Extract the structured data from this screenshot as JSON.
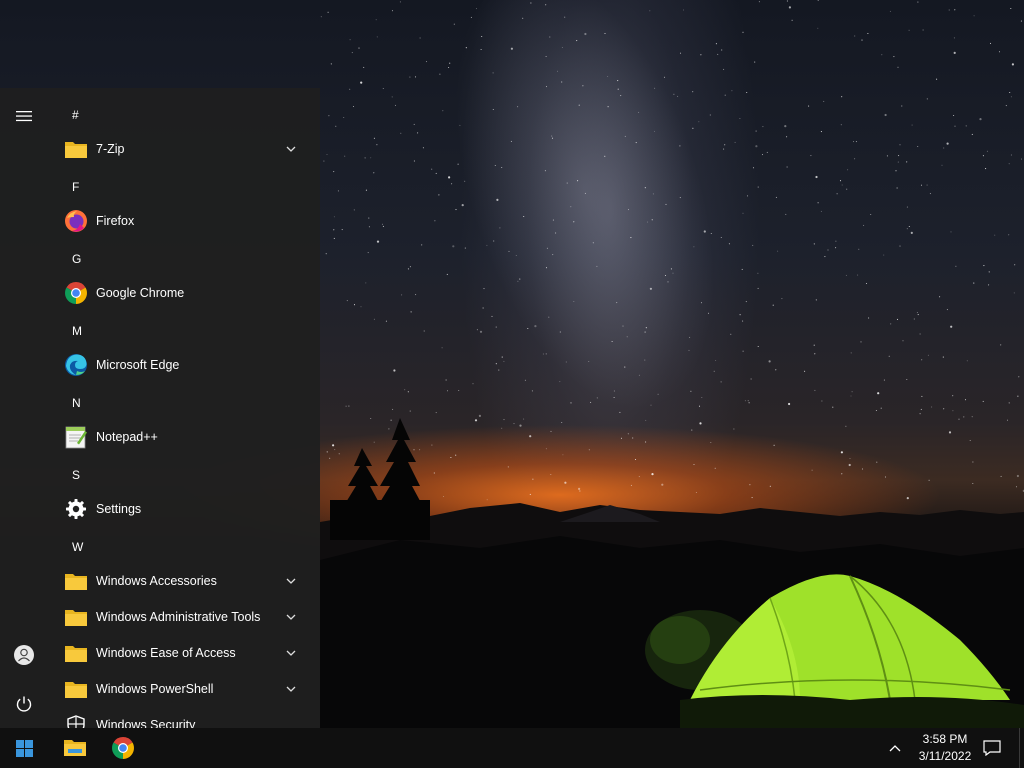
{
  "start_menu": {
    "rail": {
      "menu_icon": "hamburger-icon",
      "account_icon": "user-icon",
      "power_icon": "power-icon"
    },
    "sections": [
      {
        "letter": "#",
        "apps": [
          {
            "label": "7-Zip",
            "icon": "folder-icon",
            "expandable": true
          }
        ]
      },
      {
        "letter": "F",
        "apps": [
          {
            "label": "Firefox",
            "icon": "firefox-icon",
            "expandable": false
          }
        ]
      },
      {
        "letter": "G",
        "apps": [
          {
            "label": "Google Chrome",
            "icon": "chrome-icon",
            "expandable": false
          }
        ]
      },
      {
        "letter": "M",
        "apps": [
          {
            "label": "Microsoft Edge",
            "icon": "edge-icon",
            "expandable": false
          }
        ]
      },
      {
        "letter": "N",
        "apps": [
          {
            "label": "Notepad++",
            "icon": "notepad-plus-plus-icon",
            "expandable": false
          }
        ]
      },
      {
        "letter": "S",
        "apps": [
          {
            "label": "Settings",
            "icon": "gear-icon",
            "expandable": false
          }
        ]
      },
      {
        "letter": "W",
        "apps": [
          {
            "label": "Windows Accessories",
            "icon": "folder-icon",
            "expandable": true
          },
          {
            "label": "Windows Administrative Tools",
            "icon": "folder-icon",
            "expandable": true
          },
          {
            "label": "Windows Ease of Access",
            "icon": "folder-icon",
            "expandable": true
          },
          {
            "label": "Windows PowerShell",
            "icon": "folder-icon",
            "expandable": true
          },
          {
            "label": "Windows Security",
            "icon": "shield-icon",
            "expandable": false
          }
        ]
      }
    ]
  },
  "taskbar": {
    "start_icon": "windows-logo-icon",
    "pinned": [
      {
        "name": "File Explorer",
        "icon": "file-explorer-icon"
      },
      {
        "name": "Google Chrome",
        "icon": "chrome-icon"
      }
    ],
    "tray_icon": "chevron-up-icon",
    "clock": {
      "time": "3:58 PM",
      "date": "3/11/2022"
    },
    "notification_icon": "action-center-icon"
  },
  "colors": {
    "menu_background": "#1f1f1f",
    "taskbar_background": "#101010",
    "folder_yellow": "#f8c93c",
    "windows_blue": "#3a96dd",
    "tent_green": "#a5e82a"
  }
}
